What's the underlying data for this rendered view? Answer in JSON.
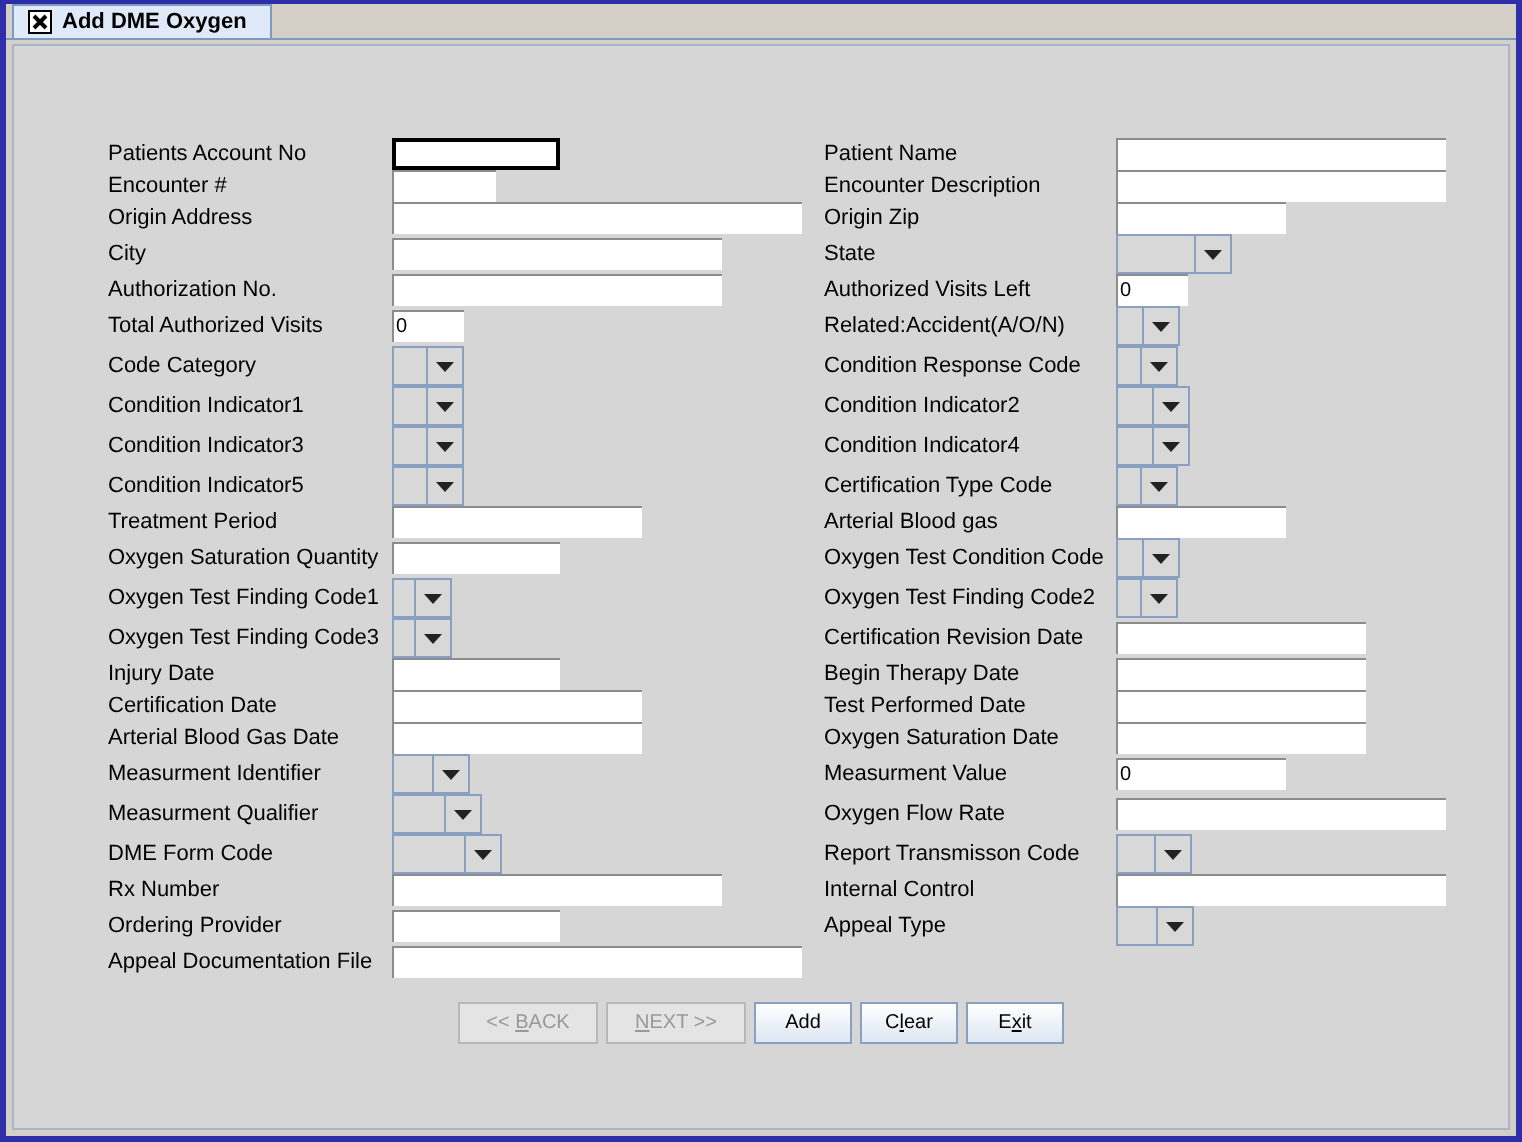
{
  "tab": {
    "title": "Add DME Oxygen",
    "selected": true
  },
  "rows": [
    {
      "left": {
        "label": "Patients Account No",
        "kind": "text",
        "focused": true
      },
      "right": {
        "label": "Patient Name",
        "kind": "text",
        "focused": false
      }
    },
    {
      "left": {
        "label": "Encounter #",
        "kind": "text",
        "focused": false
      },
      "right": {
        "label": "Encounter Description",
        "kind": "text",
        "focused": false
      }
    },
    {
      "left": {
        "label": "Origin Address",
        "kind": "text",
        "focused": false
      },
      "right": {
        "label": "Origin Zip",
        "kind": "text",
        "focused": false
      }
    },
    {
      "left": {
        "label": "City",
        "kind": "text",
        "focused": false
      },
      "right": {
        "label": "State",
        "kind": "combo",
        "focused": false
      }
    },
    {
      "left": {
        "label": "Authorization No.",
        "kind": "text",
        "focused": false
      },
      "right": {
        "label": "Authorized Visits Left",
        "kind": "text",
        "value": "0",
        "focused": false
      }
    },
    {
      "left": {
        "label": "Total Authorized Visits",
        "kind": "text",
        "value": "0",
        "focused": false
      },
      "right": {
        "label": "Related:Accident(A/O/N)",
        "kind": "combo",
        "focused": false
      }
    },
    {
      "left": {
        "label": "Code Category",
        "kind": "combo",
        "focused": false
      },
      "right": {
        "label": "Condition Response Code",
        "kind": "combo",
        "focused": false
      }
    },
    {
      "left": {
        "label": "Condition Indicator1",
        "kind": "combo",
        "focused": false
      },
      "right": {
        "label": "Condition Indicator2",
        "kind": "combo",
        "focused": false
      }
    },
    {
      "left": {
        "label": "Condition Indicator3",
        "kind": "combo",
        "focused": false
      },
      "right": {
        "label": "Condition Indicator4",
        "kind": "combo",
        "focused": false
      }
    },
    {
      "left": {
        "label": "Condition Indicator5",
        "kind": "combo",
        "focused": false
      },
      "right": {
        "label": "Certification Type Code",
        "kind": "combo",
        "focused": false
      }
    },
    {
      "left": {
        "label": "Treatment Period",
        "kind": "text",
        "focused": false
      },
      "right": {
        "label": "Arterial Blood gas",
        "kind": "text",
        "focused": false
      }
    },
    {
      "left": {
        "label": "Oxygen Saturation Quantity",
        "kind": "text",
        "focused": false
      },
      "right": {
        "label": "Oxygen Test Condition Code",
        "kind": "combo",
        "focused": false
      }
    },
    {
      "left": {
        "label": "Oxygen Test Finding Code1",
        "kind": "combo",
        "focused": false
      },
      "right": {
        "label": "Oxygen Test Finding Code2",
        "kind": "combo",
        "focused": false
      }
    },
    {
      "left": {
        "label": "Oxygen Test Finding Code3",
        "kind": "combo",
        "focused": false
      },
      "right": {
        "label": "Certification Revision Date",
        "kind": "text",
        "focused": false
      }
    },
    {
      "left": {
        "label": "Injury Date",
        "kind": "text",
        "focused": false
      },
      "right": {
        "label": "Begin Therapy Date",
        "kind": "text",
        "focused": false
      }
    },
    {
      "left": {
        "label": "Certification Date",
        "kind": "text",
        "focused": false
      },
      "right": {
        "label": "Test Performed Date",
        "kind": "text",
        "focused": false
      }
    },
    {
      "left": {
        "label": "Arterial Blood Gas Date",
        "kind": "text",
        "focused": false
      },
      "right": {
        "label": "Oxygen Saturation Date",
        "kind": "text",
        "focused": false
      }
    },
    {
      "left": {
        "label": "Measurment Identifier",
        "kind": "combo",
        "focused": false
      },
      "right": {
        "label": "Measurment Value",
        "kind": "text",
        "value": "0",
        "focused": false
      }
    },
    {
      "left": {
        "label": "Measurment Qualifier",
        "kind": "combo",
        "focused": false
      },
      "right": {
        "label": "Oxygen Flow Rate",
        "kind": "text",
        "focused": false
      }
    },
    {
      "left": {
        "label": "DME Form Code",
        "kind": "combo",
        "focused": false
      },
      "right": {
        "label": "Report Transmisson Code",
        "kind": "combo",
        "focused": false
      }
    },
    {
      "left": {
        "label": "Rx Number",
        "kind": "text",
        "focused": false
      },
      "right": {
        "label": "Internal Control",
        "kind": "text",
        "focused": false
      }
    },
    {
      "left": {
        "label": "Ordering Provider",
        "kind": "text",
        "focused": false
      },
      "right": {
        "label": "Appeal Type",
        "kind": "combo",
        "focused": false
      }
    },
    {
      "left": {
        "label": "Appeal Documentation File",
        "kind": "text",
        "focused": false
      }
    }
  ],
  "buttons": [
    {
      "label": "<< ",
      "mnemonic": "B",
      "label_rest": "ACK",
      "disabled": true
    },
    {
      "mnemonic": "N",
      "label_rest": "EXT >>",
      "disabled": true
    },
    {
      "label": "Add",
      "disabled": false
    },
    {
      "label": "C",
      "mnemonic": "l",
      "label_rest": "ear",
      "disabled": false
    },
    {
      "label": "E",
      "mnemonic": "x",
      "label_rest": "it",
      "disabled": false
    }
  ]
}
